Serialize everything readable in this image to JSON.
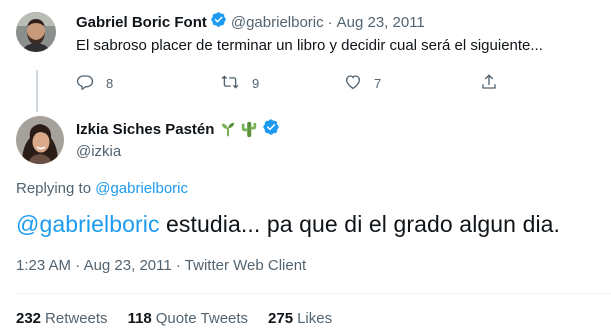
{
  "parent_tweet": {
    "author_name": "Gabriel Boric Font",
    "handle": "@gabrielboric",
    "separator": "·",
    "date": "Aug 23, 2011",
    "text": "El sabroso placer de terminar un libro y decidir cual será el siguiente...",
    "replies": "8",
    "retweets": "9",
    "likes": "7",
    "icons": [
      "reply-icon",
      "retweet-icon",
      "like-icon",
      "share-icon"
    ]
  },
  "main_tweet": {
    "author_name": "Izkia Siches Pastén",
    "name_emojis": [
      "seedling-icon",
      "cactus-icon"
    ],
    "handle": "@izkia",
    "replying_label": "Replying to",
    "replying_handle": "@gabrielboric",
    "mention": "@gabrielboric",
    "text": " estudia... pa que di el grado algun dia.",
    "time": "1:23 AM",
    "separator1": "·",
    "date": "Aug 23, 2011",
    "separator2": "·",
    "client": "Twitter Web Client"
  },
  "stats": {
    "retweets_count": "232",
    "retweets_label": "Retweets",
    "quotes_count": "118",
    "quotes_label": "Quote Tweets",
    "likes_count": "275",
    "likes_label": "Likes"
  },
  "colors": {
    "accent": "#1d9bf0",
    "text": "#0f1419",
    "secondary": "#536471"
  }
}
